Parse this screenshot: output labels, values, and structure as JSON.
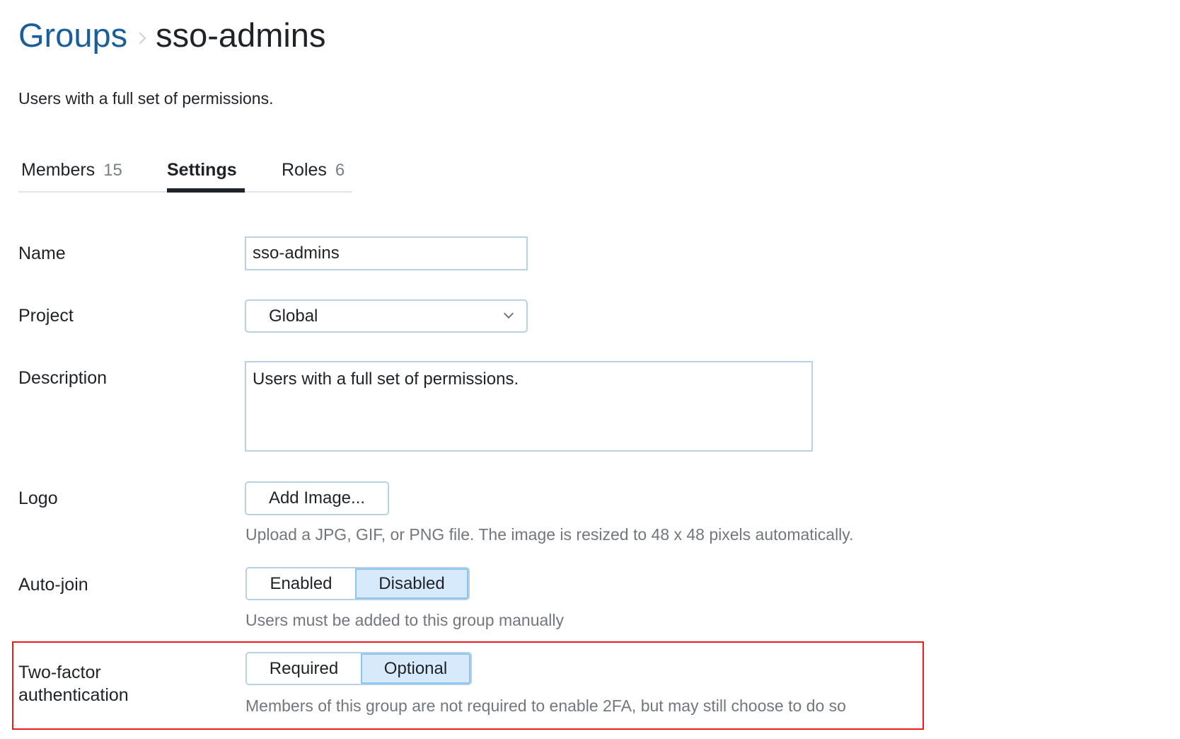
{
  "header": {
    "breadcrumb_root": "Groups",
    "breadcrumb_current": "sso-admins",
    "subtitle": "Users with a full set of permissions."
  },
  "tabs": [
    {
      "label": "Members",
      "count": "15",
      "active": false
    },
    {
      "label": "Settings",
      "count": "",
      "active": true
    },
    {
      "label": "Roles",
      "count": "6",
      "active": false
    }
  ],
  "form": {
    "name": {
      "label": "Name",
      "value": "sso-admins"
    },
    "project": {
      "label": "Project",
      "selected": "Global"
    },
    "description": {
      "label": "Description",
      "value": "Users with a full set of permissions."
    },
    "logo": {
      "label": "Logo",
      "button_label": "Add Image...",
      "hint": "Upload a JPG, GIF, or PNG file. The image is resized to 48 x 48 pixels automatically."
    },
    "auto_join": {
      "label": "Auto-join",
      "options": [
        "Enabled",
        "Disabled"
      ],
      "selected": "Disabled",
      "hint": "Users must be added to this group manually"
    },
    "two_factor": {
      "label_line1": "Two-factor",
      "label_line2": "authentication",
      "options": [
        "Required",
        "Optional"
      ],
      "selected": "Optional",
      "hint": "Members of this group are not required to enable 2FA, but may still choose to do so"
    }
  },
  "colors": {
    "link": "#1a5e9a",
    "field_border": "#b9d1e5",
    "selected_segment_bg": "#d6eafc",
    "highlight": "#ee1c1c"
  }
}
